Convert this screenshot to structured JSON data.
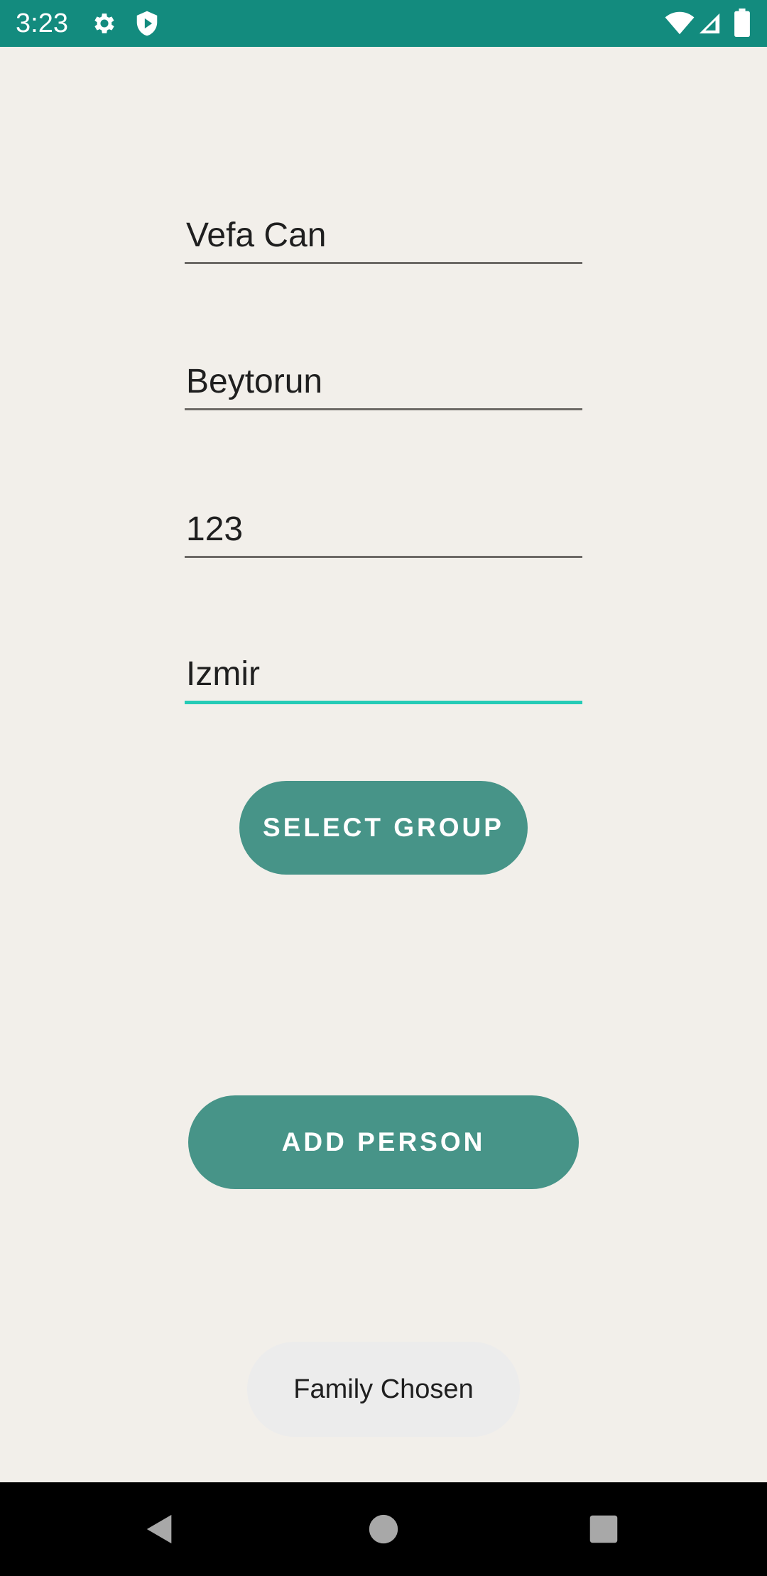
{
  "status_bar": {
    "time": "3:23",
    "background": "#138b7e",
    "left_icons": [
      "gear-icon",
      "shield-play-icon"
    ],
    "right_icons": [
      "wifi-icon",
      "cell-signal-icon",
      "battery-icon"
    ]
  },
  "form": {
    "fields": [
      {
        "name": "first-name-field",
        "value": "Vefa Can"
      },
      {
        "name": "last-name-field",
        "value": "Beytorun"
      },
      {
        "name": "phone-field",
        "value": "123"
      },
      {
        "name": "city-field",
        "value": "Izmir",
        "focused": true
      }
    ],
    "select_group_label": "SELECT GROUP",
    "add_person_label": "ADD PERSON",
    "button_color": "#479488",
    "focus_color": "#26cbb6"
  },
  "toast": {
    "message": "Family Chosen"
  },
  "nav_bar": {
    "buttons": [
      "back-icon",
      "home-icon",
      "recents-icon"
    ]
  }
}
